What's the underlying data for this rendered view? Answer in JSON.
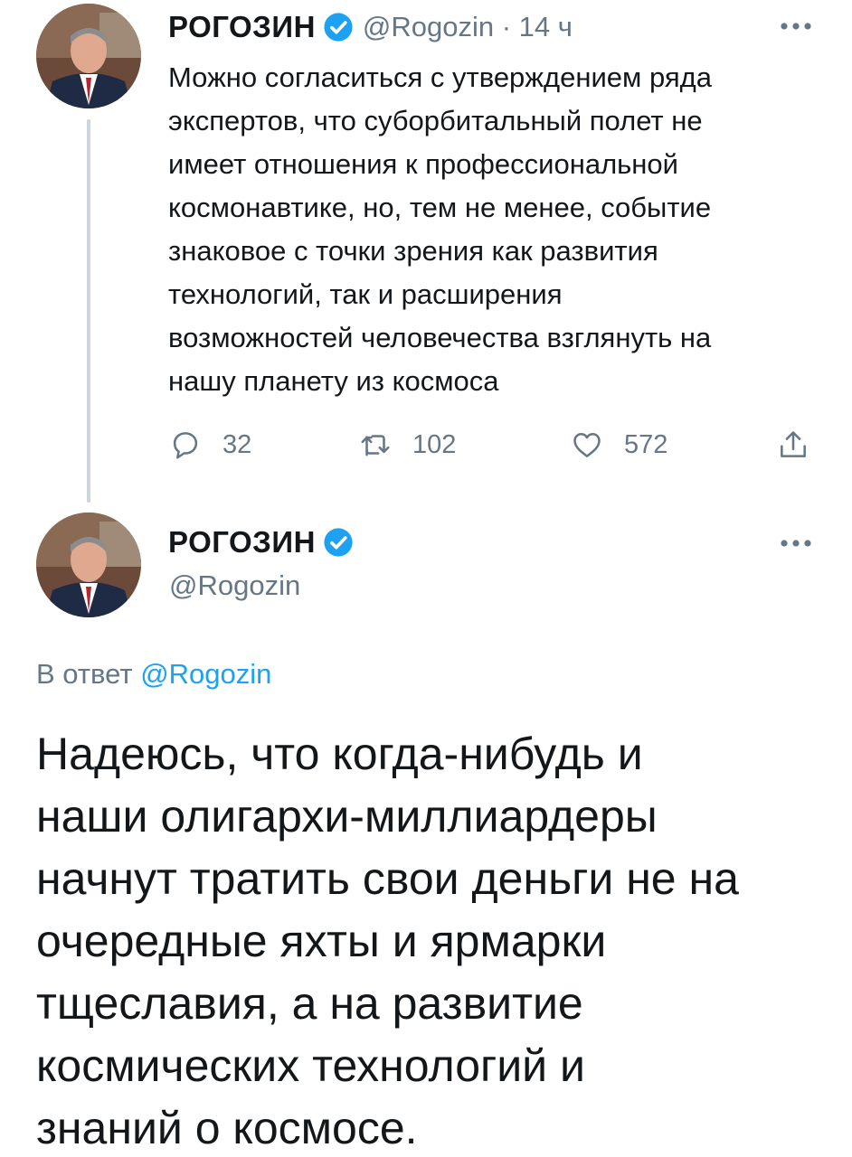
{
  "colors": {
    "verified_badge": "#1da1f2",
    "mention_link": "#1da1f2",
    "secondary_text": "#657786",
    "thread_line": "#ccd6dd"
  },
  "tweet1": {
    "author_name": "РОГОЗИН",
    "handle_time": "@Rogozin · 14 ч",
    "avatar_icon": "person-avatar",
    "verified_icon": "verified-badge-icon",
    "text_lines": [
      "Можно согласиться с утверждением ряда",
      "экспертов, что суборбитальный полет не",
      "имеет отношения к профессиональной",
      "космонавтике, но, тем не менее, событие",
      "знаковое с точки зрения как развития",
      "технологий, так и расширения",
      "возможностей человечества взглянуть на",
      "нашу планету из космоса"
    ],
    "actions": {
      "reply_count": "32",
      "retweet_count": "102",
      "like_count": "572"
    }
  },
  "tweet2": {
    "author_name": "РОГОЗИН",
    "handle": "@Rogozin",
    "avatar_icon": "person-avatar",
    "reply_prefix": "В ответ",
    "reply_mention": "@Rogozin",
    "text_lines": [
      "Надеюсь, что когда-нибудь и",
      "наши олигархи-миллиардеры",
      "начнут тратить свои деньги не на",
      "очередные яхты и ярмарки",
      "тщеславия, а на развитие",
      "космических технологий и",
      "знаний о космосе."
    ]
  }
}
